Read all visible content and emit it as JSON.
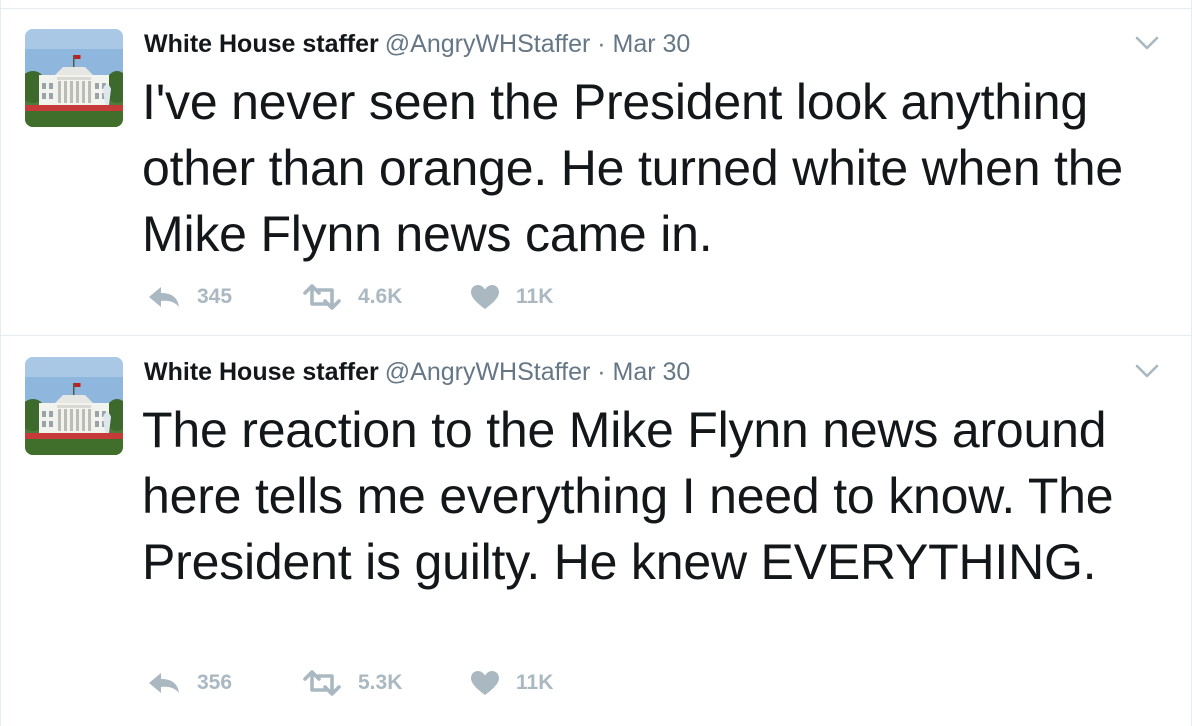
{
  "tweets": [
    {
      "author": {
        "name": "White House staffer",
        "handle": "@AngryWHStaffer",
        "avatar_icon": "white-house-avatar"
      },
      "separator": "·",
      "date": "Mar 30",
      "text": "I've never seen the President look anything other than orange. He turned white when the Mike Flynn news came in.",
      "counts": {
        "replies": "345",
        "retweets": "4.6K",
        "likes": "11K"
      }
    },
    {
      "author": {
        "name": "White House staffer",
        "handle": "@AngryWHStaffer",
        "avatar_icon": "white-house-avatar"
      },
      "separator": "·",
      "date": "Mar 30",
      "text": "The reaction to the Mike Flynn news around here tells me everything I need to know. The President is guilty. He knew EVERYTHING.",
      "counts": {
        "replies": "356",
        "retweets": "5.3K",
        "likes": "11K"
      }
    }
  ],
  "icons": {
    "reply": "reply-icon",
    "retweet": "retweet-icon",
    "like": "heart-icon",
    "menu": "chevron-down-icon"
  },
  "colors": {
    "text": "#14171a",
    "secondary": "#657786",
    "action": "#aab8c2",
    "border": "#e6ecf0"
  }
}
